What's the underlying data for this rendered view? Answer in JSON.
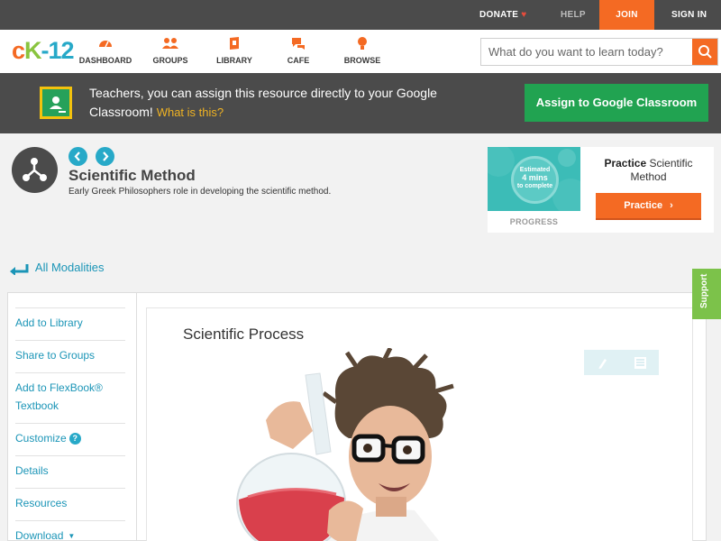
{
  "topbar": {
    "donate": "DONATE",
    "help": "HELP",
    "join": "JOIN",
    "signin": "SIGN IN"
  },
  "logo": {
    "c": "c",
    "k": "K",
    "n": "-12"
  },
  "nav": [
    {
      "label": "DASHBOARD",
      "icon": "dashboard-icon"
    },
    {
      "label": "GROUPS",
      "icon": "groups-icon"
    },
    {
      "label": "LIBRARY",
      "icon": "library-icon"
    },
    {
      "label": "CAFE",
      "icon": "cafe-icon"
    },
    {
      "label": "BROWSE",
      "icon": "browse-icon"
    }
  ],
  "search": {
    "placeholder": "What do you want to learn today?"
  },
  "banner": {
    "text": "Teachers, you can assign this resource directly to your Google Classroom!",
    "what": "What is this?",
    "assign_label": "Assign to Google Classroom"
  },
  "concept": {
    "title": "Scientific Method",
    "description": "Early Greek Philosophers role in developing the scientific method."
  },
  "practice": {
    "estimate_line1": "Estimated",
    "estimate_line2": "4 mins",
    "estimate_line3": "to complete",
    "progress_label": "PROGRESS",
    "title_bold": "Practice",
    "title_rest": "Scientific Method",
    "button_label": "Practice"
  },
  "modalities": {
    "label": "All Modalities"
  },
  "sidebar": {
    "items": [
      {
        "label": "Add to Library"
      },
      {
        "label": "Share to Groups"
      },
      {
        "label": "Add to FlexBook® Textbook"
      },
      {
        "label": "Customize"
      },
      {
        "label": "Details"
      },
      {
        "label": "Resources"
      },
      {
        "label": "Download"
      }
    ]
  },
  "content": {
    "title": "Scientific Process"
  },
  "support": {
    "label": "Support"
  },
  "colors": {
    "accent_orange": "#f46a23",
    "accent_teal": "#27a9c8",
    "google_green": "#21a351",
    "support_green": "#7cc24a",
    "dark_bar": "#4b4b4b"
  }
}
